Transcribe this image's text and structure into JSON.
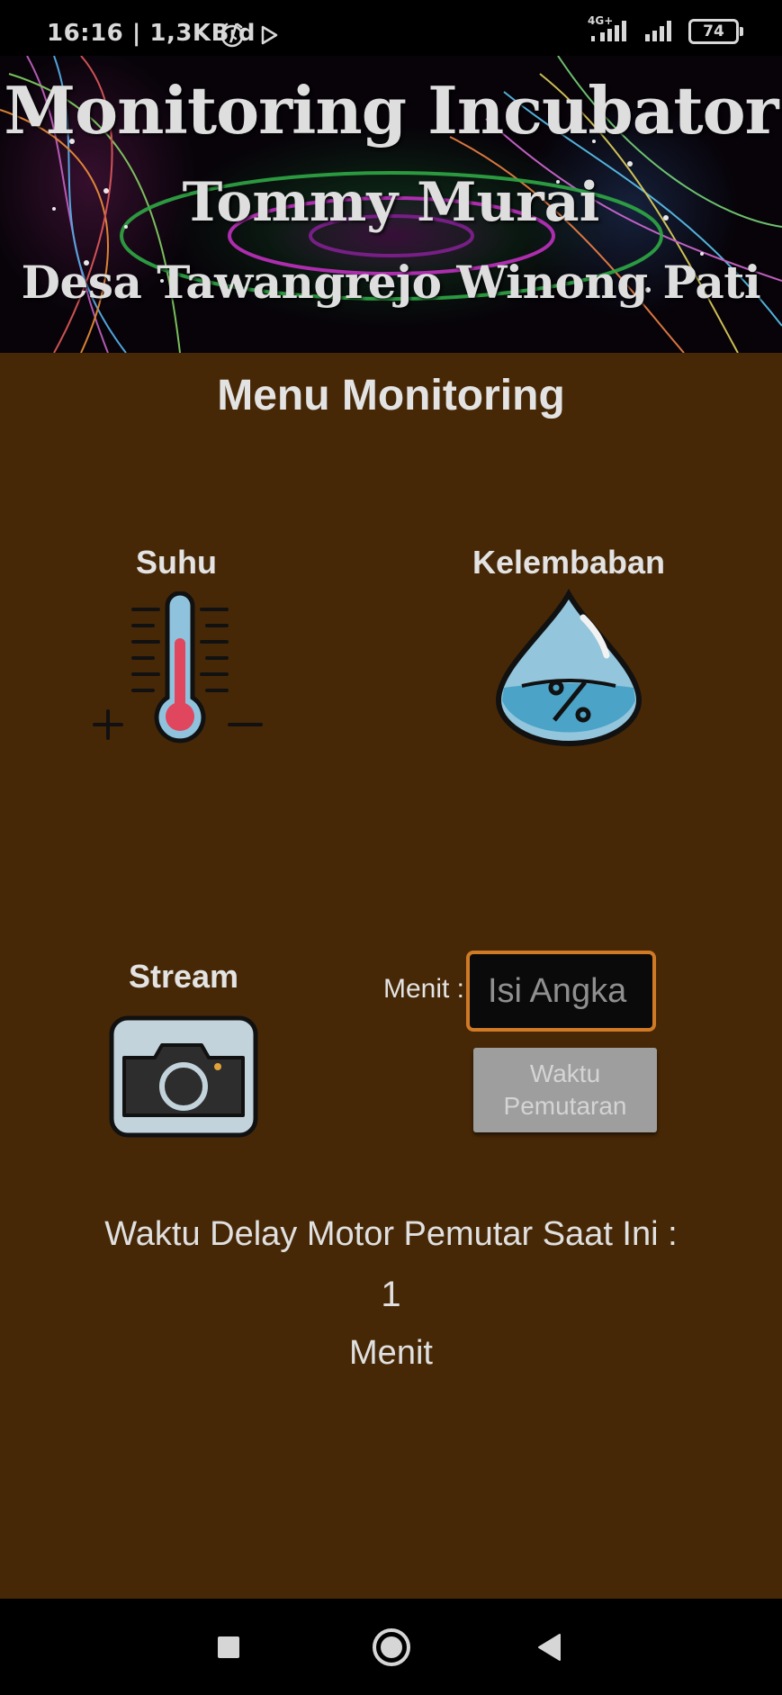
{
  "status_bar": {
    "time": "16:16",
    "network_speed": "| 1,3KB/d",
    "network_type": "4G+",
    "battery_level": "74",
    "icons": [
      "alarm-clock-icon",
      "play-store-icon",
      "signal-4g-icon",
      "signal-icon",
      "battery-icon"
    ]
  },
  "banner": {
    "title": "Monitoring Incubator",
    "subtitle_name": "Tommy Murai",
    "subtitle_location": "Desa Tawangrejo Winong Pati"
  },
  "main": {
    "menu_title": "Menu Monitoring",
    "tiles": {
      "temperature_label": "Suhu",
      "humidity_label": "Kelembaban",
      "stream_label": "Stream"
    },
    "delay_form": {
      "minutes_label": "Menit :",
      "minutes_placeholder": "Isi Angka",
      "minutes_value": "",
      "submit_label": "Waktu Pemutaran"
    },
    "delay_info": {
      "label": "Waktu Delay Motor Pemutar Saat Ini :",
      "value": "1",
      "unit": "Menit"
    }
  },
  "colors": {
    "content_background": "#472806",
    "input_border": "#d07a26",
    "button_background": "#9e9e9e",
    "status_background": "#000000"
  },
  "nav_bar": {
    "icons": [
      "recent-apps-icon",
      "home-icon",
      "back-icon"
    ]
  }
}
